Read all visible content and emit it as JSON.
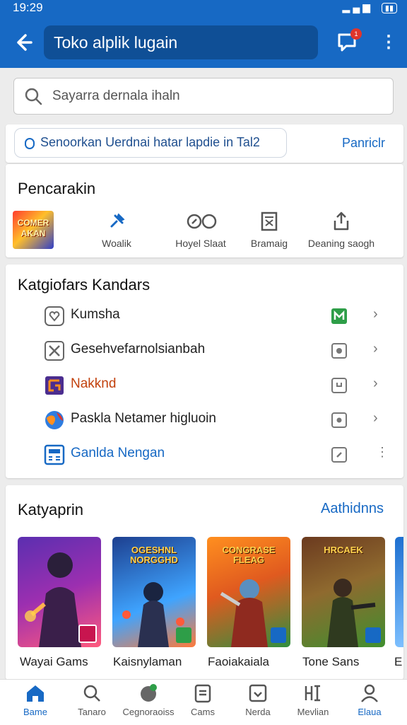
{
  "status": {
    "time": "19:29",
    "icons": "▲ ▮▮▮ ▼"
  },
  "appbar": {
    "title": "Toko alplik lugain",
    "notif_count": "1"
  },
  "search": {
    "placeholder": "Sayarra dernala ihaln"
  },
  "suggestion": {
    "text": "Senoorkan Uerdnai hatar lapdie in Tal2",
    "link": "Panriclr"
  },
  "pencarian": {
    "title": "Pencarakin",
    "items": [
      {
        "label": "",
        "icon": "game-thumbnail",
        "art": "COMER AKAN"
      },
      {
        "label": "Woalik",
        "icon": "pin-icon"
      },
      {
        "label": "Hoyel Slaat",
        "icon": "toggle-icon"
      },
      {
        "label": "Bramaig",
        "icon": "document-icon"
      },
      {
        "label": "Deaning saogh",
        "icon": "share-icon"
      }
    ]
  },
  "kategori": {
    "title": "Katgiofars Kandars",
    "items": [
      {
        "label": "Kumsha",
        "icon": "heart-icon",
        "color": "#222222",
        "badge": "green-badge",
        "trail": "chevron"
      },
      {
        "label": "Gesehvefarnolsianbah",
        "icon": "tools-icon",
        "color": "#222222",
        "badge": "grey-badge",
        "trail": "chevron"
      },
      {
        "label": "Nakknd",
        "icon": "puzzle-icon",
        "color": "#c2410c",
        "badge": "grey-badge",
        "trail": "chevron"
      },
      {
        "label": "Paskla Netamer higluoin",
        "icon": "globe-icon",
        "color": "#222222",
        "badge": "grey-badge",
        "trail": "chevron"
      },
      {
        "label": "Ganlda Nengan",
        "icon": "calculator-icon",
        "color": "#1769c4",
        "badge": "grey-badge",
        "trail": "dots"
      }
    ]
  },
  "katalog": {
    "title": "Katyaprin",
    "link": "Aathidnns",
    "tiles": [
      {
        "name": "Wayai Gams",
        "art": "",
        "bg1": "#5b2fb0",
        "bg2": "#ff5a7d"
      },
      {
        "name": "Kaisnylaman",
        "art": "OGESHNL NORGGHD",
        "bg1": "#1d3f8f",
        "bg2": "#3fa4ff"
      },
      {
        "name": "Faoiakaiala",
        "art": "CONGRASE FLEAG",
        "bg1": "#ff8f1f",
        "bg2": "#2f8f3f"
      },
      {
        "name": "Tone Sans",
        "art": "HRCAEK",
        "bg1": "#6b3a1f",
        "bg2": "#3f8f2f"
      },
      {
        "name": "E",
        "art": "",
        "bg1": "#1d6fd0",
        "bg2": "#7ec0ff"
      }
    ]
  },
  "bottomnav": [
    {
      "label": "Bame",
      "icon": "home-icon",
      "active": true
    },
    {
      "label": "Tanaro",
      "icon": "search-icon",
      "active": false
    },
    {
      "label": "Cegnoraoiss",
      "icon": "games-icon",
      "active": false
    },
    {
      "label": "Cams",
      "icon": "list-icon",
      "active": false
    },
    {
      "label": "Nerda",
      "icon": "image-icon",
      "active": false
    },
    {
      "label": "Mevlian",
      "icon": "apps-icon",
      "active": false
    },
    {
      "label": "Elaua",
      "icon": "person-icon",
      "active": false
    }
  ],
  "colors": {
    "brand": "#1769c4",
    "brand_dark": "#0f4f96",
    "alert": "#e0352b"
  }
}
